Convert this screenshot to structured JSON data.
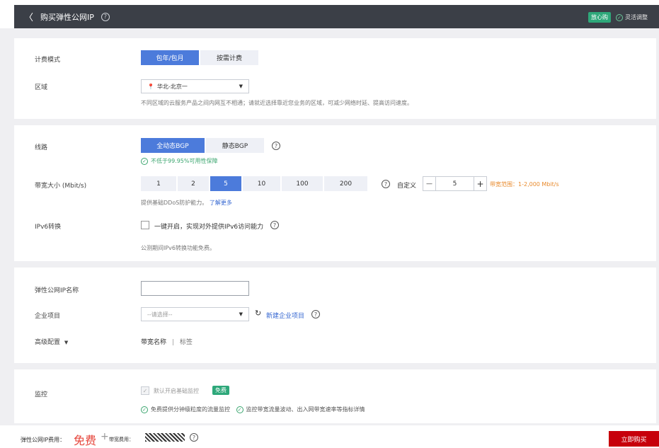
{
  "header": {
    "back_glyph": "〈",
    "title": "购买弹性公网IP",
    "help_icon": "question-circle-icon",
    "badge": "放心购",
    "flex_adjust": "灵活调整"
  },
  "billing": {
    "label": "计费模式",
    "options": [
      "包年/包月",
      "按需计费"
    ],
    "selected": "包年/包月"
  },
  "region": {
    "label": "区域",
    "value": "华北-北京一",
    "hint": "不同区域的云服务产品之间内网互不相通；请就近选择靠近您业务的区域，可减少网络时延、提高访问速度。"
  },
  "line": {
    "label": "线路",
    "options": [
      "全动态BGP",
      "静态BGP"
    ],
    "selected": "全动态BGP",
    "guarantee": "不低于99.95%可用性保障"
  },
  "bandwidth": {
    "label": "带宽大小 (Mbit/s)",
    "options": [
      "1",
      "2",
      "5",
      "10",
      "100",
      "200"
    ],
    "selected": "5",
    "custom_label": "自定义",
    "stepper_value": "5",
    "minus": "—",
    "plus": "+",
    "range": "带宽范围：1-2,000 Mbit/s",
    "ddos_text": "提供基础DDoS防护能力。",
    "ddos_link": "了解更多"
  },
  "ipv6": {
    "label": "IPv6转换",
    "checkbox_label": "一键开启，实现对外提供IPv6访问能力",
    "hint": "公测期间IPv6转换功能免费。"
  },
  "name": {
    "label": "弹性公网IP名称",
    "value": ""
  },
  "enterprise": {
    "label": "企业项目",
    "placeholder": "--请选择--",
    "new_link": "新建企业项目"
  },
  "advanced": {
    "label": "高级配置",
    "items": [
      "带宽名称",
      "标签"
    ],
    "separator": "|"
  },
  "monitor": {
    "label": "监控",
    "checkbox_label": "默认开启基础监控",
    "free_badge": "免费",
    "feature1": "免费提供分钟级粒度的流量监控",
    "feature2": "监控带宽流量波动、出入网带宽速率等指标详情"
  },
  "footer": {
    "eip_fee_label": "弹性公网IP费用：",
    "eip_fee_value": "免费",
    "plus": "+",
    "bw_fee_label": "带宽费用：",
    "buy_button": "立即购买"
  },
  "colors": {
    "primary": "#4c7bdb",
    "danger": "#c7000b",
    "success": "#3aa56e",
    "header_bg": "#3b3f47"
  }
}
